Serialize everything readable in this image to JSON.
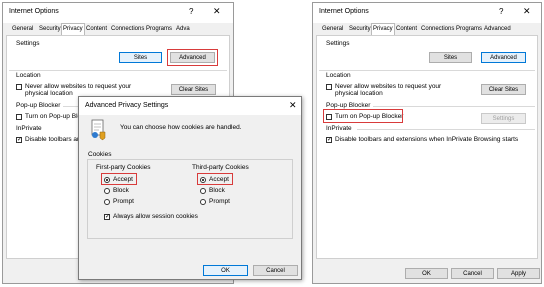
{
  "left": {
    "title": "Internet Options",
    "help": "?",
    "close": "✕",
    "tabs": [
      "General",
      "Security",
      "Privacy",
      "Content",
      "Connections",
      "Programs",
      "Adva"
    ],
    "settings_label": "Settings",
    "sites_btn": "Sites",
    "advanced_btn": "Advanced",
    "location_label": "Location",
    "never_allow_1": "Never allow websites to request your",
    "never_allow_2": "physical location",
    "clear_sites_btn": "Clear Sites",
    "popup_label": "Pop-up Blocker",
    "turn_on_popup": "Turn on Pop-up Block",
    "inprivate_label": "InPrivate",
    "disable_toolbars": "Disable toolbars and"
  },
  "dialog": {
    "title": "Advanced Privacy Settings",
    "close": "✕",
    "message": "You can choose how cookies are handled.",
    "cookies_label": "Cookies",
    "first_party": "First-party Cookies",
    "third_party": "Third-party Cookies",
    "accept": "Accept",
    "block": "Block",
    "prompt": "Prompt",
    "always_allow": "Always allow session cookies",
    "ok": "OK",
    "cancel": "Cancel"
  },
  "right": {
    "title": "Internet Options",
    "help": "?",
    "close": "✕",
    "tabs": [
      "General",
      "Security",
      "Privacy",
      "Content",
      "Connections",
      "Programs",
      "Advanced"
    ],
    "settings_label": "Settings",
    "sites_btn": "Sites",
    "advanced_btn": "Advanced",
    "location_label": "Location",
    "never_allow_1": "Never allow websites to request your",
    "never_allow_2": "physical location",
    "clear_sites_btn": "Clear Sites",
    "popup_label": "Pop-up Blocker",
    "turn_on_popup": "Turn on Pop-up Blocker",
    "settings_btn": "Settings",
    "inprivate_label": "InPrivate",
    "disable_toolbars": "Disable toolbars and extensions when InPrivate Browsing starts",
    "ok": "OK",
    "cancel": "Cancel",
    "apply": "Apply"
  },
  "colors": {
    "highlight": "#d83b3b",
    "focus_blue": "#0078d7"
  }
}
